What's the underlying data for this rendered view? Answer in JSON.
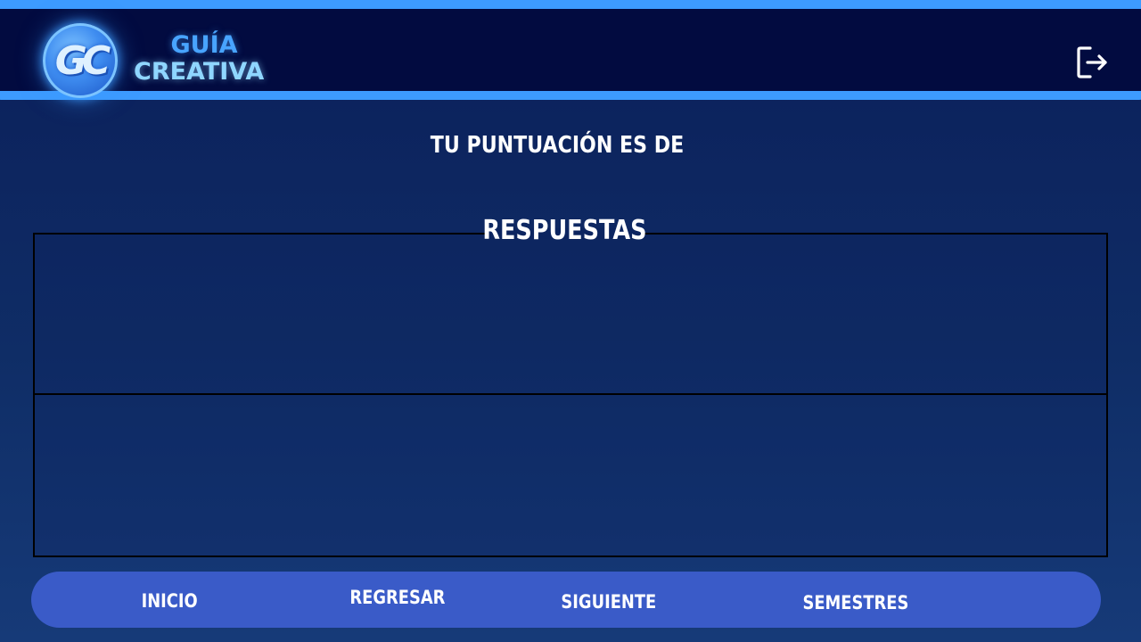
{
  "header": {
    "logo_letters": "GC",
    "brand_line1": "GUÍA",
    "brand_line2": "CREATIVA",
    "logout_icon": "logout-icon"
  },
  "main": {
    "score_title": "TU PUNTUACIÓN ES DE",
    "answers_title": "RESPUESTAS"
  },
  "nav": {
    "inicio": "INICIO",
    "regresar": "REGRESAR",
    "siguiente": "SIGUIENTE",
    "semestres": "SEMESTRES"
  },
  "colors": {
    "header_bg": "#020b40",
    "header_border": "#3d9bff",
    "page_bg": "#0f2d66",
    "nav_bg": "#3a5bc8",
    "brand_blue": "#48a4ff",
    "brand_light": "#8fd6ff"
  }
}
